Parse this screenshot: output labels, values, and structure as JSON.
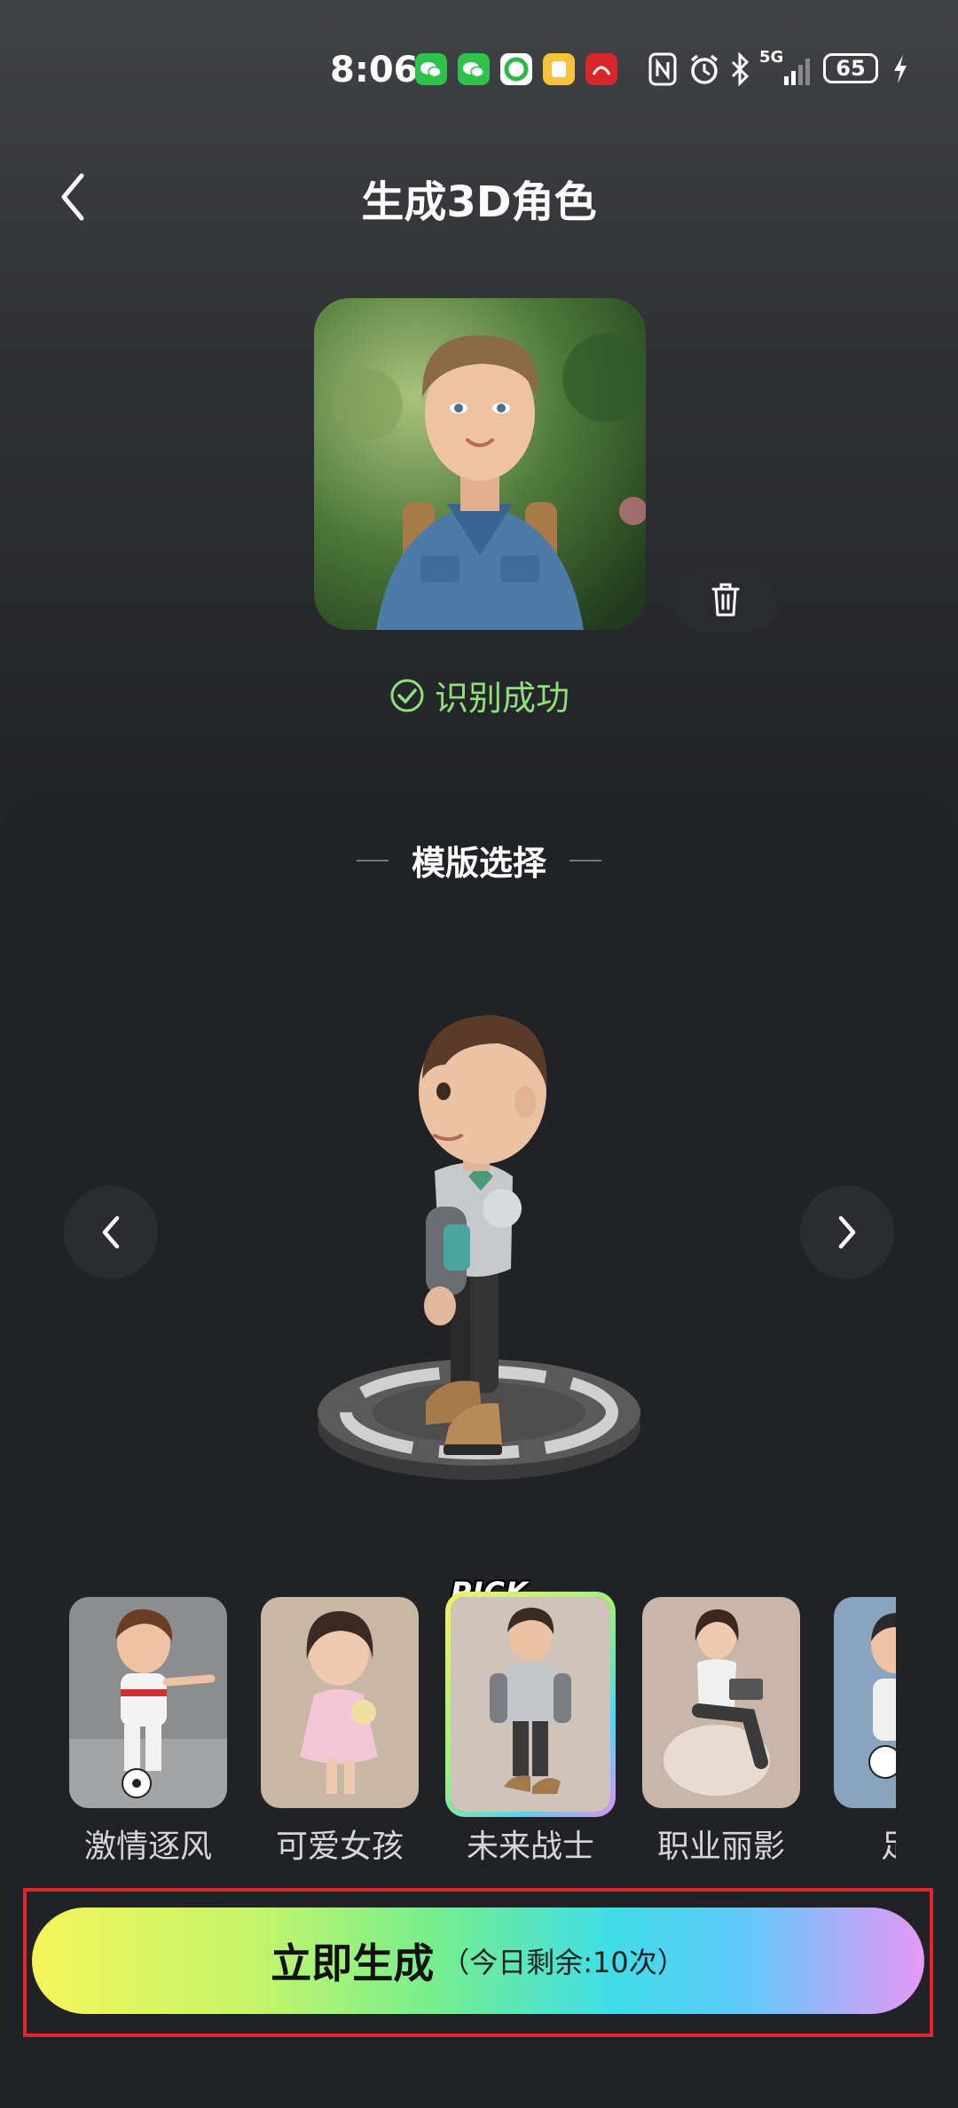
{
  "status_bar": {
    "time": "8:06",
    "network": "5G",
    "battery": "65",
    "notification_icons": [
      "wechat-icon",
      "wechat-icon",
      "app-icon",
      "app-icon",
      "app-icon"
    ],
    "system_icons": [
      "nfc-icon",
      "alarm-icon",
      "bluetooth-icon",
      "signal-icon",
      "charging-icon"
    ]
  },
  "header": {
    "title": "生成3D角色"
  },
  "photo": {
    "status_text": "识别成功"
  },
  "templates": {
    "section_title": "模版选择",
    "pick_badge": "PICK",
    "items": [
      {
        "label": "激情逐风",
        "selected": false
      },
      {
        "label": "可爱女孩",
        "selected": false
      },
      {
        "label": "未来战士",
        "selected": true
      },
      {
        "label": "职业丽影",
        "selected": false
      },
      {
        "label": "足球",
        "selected": false
      }
    ]
  },
  "generate": {
    "label": "立即生成",
    "remaining": "（今日剩余:10次）"
  },
  "colors": {
    "success": "#8fe07a",
    "highlight": "#e0262a",
    "background": "#202124"
  }
}
